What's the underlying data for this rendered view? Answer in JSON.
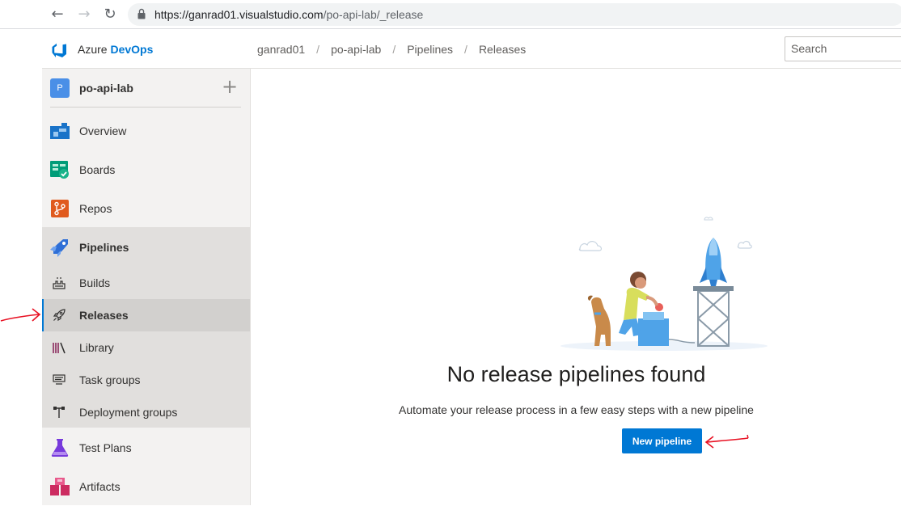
{
  "browser": {
    "url_host": "https://ganrad01.visualstudio.com",
    "url_path": "/po-api-lab/_release"
  },
  "header": {
    "brand_prefix": "Azure",
    "brand_name": "DevOps",
    "breadcrumbs": [
      "ganrad01",
      "po-api-lab",
      "Pipelines",
      "Releases"
    ],
    "search_placeholder": "Search"
  },
  "project": {
    "avatar_letter": "P",
    "name": "po-api-lab"
  },
  "nav": {
    "items": [
      {
        "label": "Overview",
        "icon": "overview-icon"
      },
      {
        "label": "Boards",
        "icon": "boards-icon"
      },
      {
        "label": "Repos",
        "icon": "repos-icon"
      },
      {
        "label": "Pipelines",
        "icon": "pipelines-icon"
      },
      {
        "label": "Test Plans",
        "icon": "test-plans-icon"
      },
      {
        "label": "Artifacts",
        "icon": "artifacts-icon"
      }
    ],
    "pipeline_subitems": [
      {
        "label": "Builds",
        "icon": "builds-icon"
      },
      {
        "label": "Releases",
        "icon": "rocket-icon",
        "active": true
      },
      {
        "label": "Library",
        "icon": "library-icon"
      },
      {
        "label": "Task groups",
        "icon": "task-groups-icon"
      },
      {
        "label": "Deployment groups",
        "icon": "deployment-groups-icon"
      }
    ]
  },
  "main": {
    "empty_title": "No release pipelines found",
    "empty_subtitle": "Automate your release process in a few easy steps with a new pipeline",
    "new_pipeline_label": "New pipeline"
  },
  "colors": {
    "accent": "#0078d4",
    "sidebar_bg": "#f3f2f1",
    "annotation": "#e81123"
  }
}
